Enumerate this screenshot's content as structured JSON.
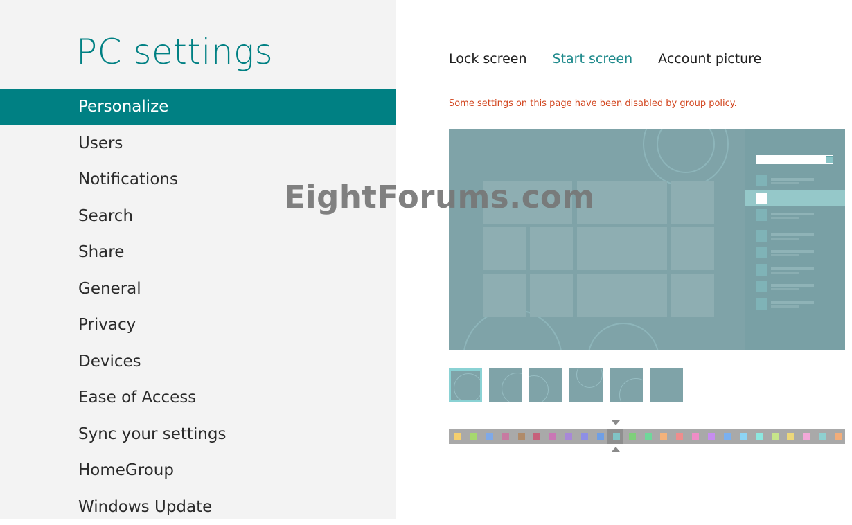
{
  "app": {
    "title": "PC settings"
  },
  "nav": {
    "items": [
      {
        "label": "Personalize",
        "selected": true
      },
      {
        "label": "Users"
      },
      {
        "label": "Notifications"
      },
      {
        "label": "Search"
      },
      {
        "label": "Share"
      },
      {
        "label": "General"
      },
      {
        "label": "Privacy"
      },
      {
        "label": "Devices"
      },
      {
        "label": "Ease of Access"
      },
      {
        "label": "Sync your settings"
      },
      {
        "label": "HomeGroup"
      },
      {
        "label": "Windows Update"
      }
    ]
  },
  "tabs": [
    {
      "label": "Lock screen"
    },
    {
      "label": "Start screen",
      "active": true
    },
    {
      "label": "Account picture"
    }
  ],
  "policy_notice": "Some settings on this page have been disabled by group policy.",
  "background": {
    "selected_index": 0,
    "count": 6
  },
  "color_scheme": {
    "selected_index": 10,
    "swatches": [
      "#f5cf6e",
      "#a6d86e",
      "#7fa9e8",
      "#c87aa1",
      "#b08b6a",
      "#c7617b",
      "#c977b5",
      "#a888d8",
      "#8e8fe6",
      "#6f9fe6",
      "#80c3c5",
      "#7fcf7a",
      "#6fd89a",
      "#f4b27a",
      "#ef8d8d",
      "#ef8dc6",
      "#c68df0",
      "#7ab0f0",
      "#8dd4f5",
      "#8de8e0",
      "#c7e68a",
      "#ecd77a",
      "#f2a8d8",
      "#8fd0d0",
      "#f2ad7a"
    ]
  },
  "colors": {
    "accent": "#008083",
    "warning": "#d2451e",
    "preview_bg": "#7fa3a8"
  },
  "watermark": "EightForums.com"
}
